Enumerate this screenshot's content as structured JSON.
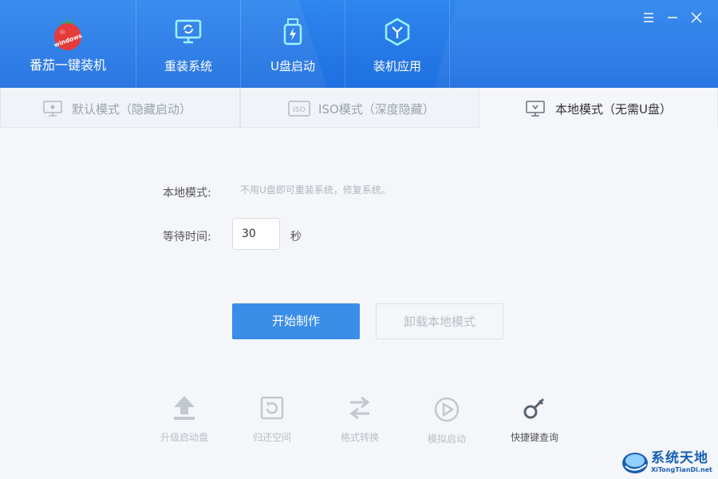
{
  "brand": {
    "title": "番茄一键装机",
    "logo_icon": "tomato-logo-icon",
    "logo_text": "windows"
  },
  "nav": {
    "items": [
      {
        "label": "重装系统",
        "icon": "monitor-refresh-icon"
      },
      {
        "label": "U盘启动",
        "icon": "usb-drive-icon"
      },
      {
        "label": "装机应用",
        "icon": "app-hexagon-icon"
      }
    ]
  },
  "window_controls": {
    "menu_icon": "menu-icon",
    "minimize_icon": "minimize-icon",
    "close_icon": "close-icon"
  },
  "tabs": [
    {
      "label": "默认模式（隐藏启动）",
      "icon": "monitor-icon",
      "active": false
    },
    {
      "label": "ISO模式（深度隐藏）",
      "icon": "iso-icon",
      "active": false
    },
    {
      "label": "本地模式（无需U盘）",
      "icon": "monitor-icon",
      "active": true
    }
  ],
  "form": {
    "mode_label": "本地模式:",
    "mode_description": "不用U盘即可重装系统，修复系统。",
    "wait_label": "等待时间:",
    "wait_value": "30",
    "wait_unit": "秒"
  },
  "buttons": {
    "start": "开始制作",
    "uninstall": "卸载本地模式"
  },
  "tools": [
    {
      "label": "升级启动盘",
      "icon": "upload-arrow-icon"
    },
    {
      "label": "归还空间",
      "icon": "restore-icon"
    },
    {
      "label": "格式转换",
      "icon": "swap-arrows-icon"
    },
    {
      "label": "模拟启动",
      "icon": "play-circle-icon"
    },
    {
      "label": "快捷键查询",
      "icon": "key-icon"
    }
  ],
  "watermark": {
    "title": "系统天地",
    "url": "XiTongTianDi.net"
  },
  "colors": {
    "header": "#2a7de8",
    "primary_button": "#3a8ee8",
    "disabled_text": "#b9bfc7"
  }
}
